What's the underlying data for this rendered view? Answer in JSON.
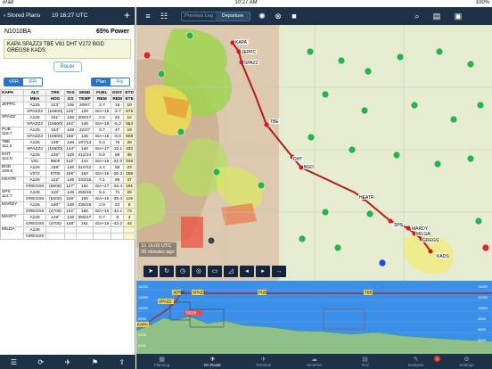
{
  "status_bar": {
    "carrier": "iPad",
    "time": "10:27 AM",
    "battery": "100%"
  },
  "left_panel": {
    "back_label": "Stored Plans",
    "date": "10 16:27 UTC",
    "add_icon": "plus-icon",
    "tail_number": "N1010BA",
    "power": "65% Power",
    "route_text": "KAPA SPAZZ3 TBE V81 DHT V272 BGD GREGS8 KADS",
    "route_button": "Route",
    "rules": {
      "options": [
        "VFR",
        "IFR"
      ],
      "selected": "VFR"
    },
    "mode": {
      "options": [
        "Plan",
        "Fly"
      ],
      "selected": "Plan"
    },
    "table": {
      "header1": [
        "KAPA",
        "ALT",
        "TRK",
        "TAS",
        "WIND",
        "FUEL",
        "DIST",
        "ETD"
      ],
      "header2": [
        "",
        "MEA",
        "HDG",
        "GS",
        "TEMP",
        "REM",
        "REM",
        "ETE"
      ],
      "rows": [
        {
          "wp": "JEPPC",
          "sub": "",
          "r1": [
            "A125",
            "123°",
            "105",
            "209/7",
            "2.7",
            "16",
            "10"
          ],
          "r2": [
            "",
            "SPAZZ3",
            "(16600)",
            "126°",
            "129",
            "ISA+18",
            "-2.7",
            "575"
          ]
        },
        {
          "wp": "SPAZZ",
          "sub": "",
          "r1": [
            "A125",
            "151°",
            "148",
            "209/17",
            "2.6",
            "22",
            "12"
          ],
          "r2": [
            "",
            "SPAZZ3",
            "(16600)",
            "152°",
            "148",
            "ISA+18",
            "-5.3",
            "553"
          ]
        },
        {
          "wp": "PUB",
          "sub": "116.7",
          "r1": [
            "A125",
            "154°",
            "148",
            "224/7",
            "3.7",
            "47",
            "19"
          ],
          "r2": [
            "",
            "SPAZZ3",
            "(16600)",
            "158°",
            "145",
            "ISA+19",
            "-9.0",
            "506"
          ]
        },
        {
          "wp": "TBE",
          "sub": "111.2",
          "r1": [
            "A125",
            "139°",
            "148",
            "197/13",
            "5.3",
            "75",
            "28"
          ],
          "r2": [
            "",
            "SPAZZ3",
            "(16600)",
            "144°",
            "140",
            "ISA+17",
            "-15.1",
            "432"
          ]
        },
        {
          "wp": "DHT",
          "sub": "112.0",
          "r1": [
            "A125",
            "136°",
            "148",
            "212/14",
            "6.8",
            "86",
            "36"
          ],
          "r2": [
            "",
            "V81",
            "8800",
            "142°",
            "144",
            "ISA+16",
            "-22.0",
            "346"
          ]
        },
        {
          "wp": "BGD",
          "sub": "108.6",
          "r1": [
            "A125",
            "108°",
            "148",
            "210/12",
            "4.4",
            "59",
            "23"
          ],
          "r2": [
            "",
            "V272",
            "5700",
            "105°",
            "153",
            "ISA+16",
            "-26.3",
            "286"
          ]
        },
        {
          "wp": "HEATR",
          "sub": "",
          "r1": [
            "A125",
            "122°",
            "148",
            "233/15",
            "7.1",
            "95",
            "37"
          ],
          "r2": [
            "",
            "GREGS8",
            "(6600)",
            "127°",
            "152",
            "ISA+17",
            "-33.4",
            "191"
          ]
        },
        {
          "wp": "SPS",
          "sub": "112.7",
          "r1": [
            "A125",
            "118°",
            "148",
            "258/16",
            "5.2",
            "71",
            "29"
          ],
          "r2": [
            "",
            "GREGS8",
            "(6200)",
            "126°",
            "160",
            "ISA+16",
            "-39.4",
            "119"
          ]
        },
        {
          "wp": "MARDY",
          "sub": "",
          "r1": [
            "A125",
            "100°",
            "148",
            "239/16",
            "2.9",
            "22",
            "8"
          ],
          "r2": [
            "",
            "GREGS8",
            "(4700)",
            "101°",
            "165",
            "ISA+16",
            "-42.1",
            "73"
          ]
        },
        {
          "wp": "MASTY",
          "sub": "",
          "r1": [
            "A125",
            "149°",
            "148",
            "255/17",
            "0.7",
            "9",
            "4"
          ],
          "r2": [
            "",
            "GREGS8",
            "(4700)",
            "148°",
            "161",
            "ISA+16",
            "-43.2",
            "44"
          ]
        },
        {
          "wp": "MILDA",
          "sub": "",
          "r1": [
            "A125",
            "",
            "",
            "",
            "",
            "",
            ""
          ],
          "r2": [
            "",
            "GREGS8",
            "",
            "",
            "",
            "",
            "",
            ""
          ]
        }
      ]
    },
    "toolbar_icons": [
      "list-icon",
      "refresh-icon",
      "airplane-icon",
      "flag-icon",
      "share-icon"
    ]
  },
  "top_toolbar": {
    "segments": [
      "Previous Leg",
      "Departure"
    ],
    "selected": "Departure",
    "icons_left": [
      "layers-icon",
      "list-icon"
    ],
    "icons_mid": [
      "brightness-icon",
      "lock-icon",
      "stop-icon"
    ],
    "icons_right": [
      "search-icon",
      "menu-icon",
      "video-icon"
    ]
  },
  "map": {
    "waypoints": [
      "KAPA",
      "JEPPC",
      "SPAZZ",
      "TBE",
      "DHT",
      "BGD",
      "HEATR",
      "SPS",
      "MARDY",
      "MILGA",
      "GREGS",
      "KADS"
    ],
    "timestamp": "10 16:00 UTC",
    "age": "28 minutes ago",
    "tools": [
      "nav-arrow-icon",
      "track-icon",
      "clock-icon",
      "compass-icon",
      "route-icon",
      "profile-icon",
      "back-icon",
      "forward-icon",
      "next-icon"
    ]
  },
  "profile": {
    "labels": [
      "JEPPC",
      "SPAZZ",
      "PUB",
      "TBE",
      "KAPA",
      "BGD",
      "MARDY"
    ],
    "alt_left": [
      "14000",
      "12000",
      "10000",
      "8000",
      "6000",
      "4000"
    ],
    "alt_right": [
      "14000",
      "12000",
      "10000",
      "8000",
      "6000",
      "4000"
    ],
    "obstacle": "7651ft"
  },
  "bottom_tabs": [
    {
      "label": "Planning",
      "icon": "planning-icon"
    },
    {
      "label": "En Route",
      "icon": "airplane-icon"
    },
    {
      "label": "Terminal",
      "icon": "runway-icon"
    },
    {
      "label": "Weather",
      "icon": "cloud-icon"
    },
    {
      "label": "Text",
      "icon": "doc-icon"
    },
    {
      "label": "Notepad",
      "icon": "pad-icon"
    },
    {
      "label": "Settings",
      "icon": "gear-icon"
    }
  ],
  "selected_tab": "En Route",
  "settings_badge": "1",
  "colors": {
    "nav": "#1d3147",
    "route": "#b61a1a",
    "sky": "#3a8fe8",
    "terrain": "#8fc08a"
  }
}
